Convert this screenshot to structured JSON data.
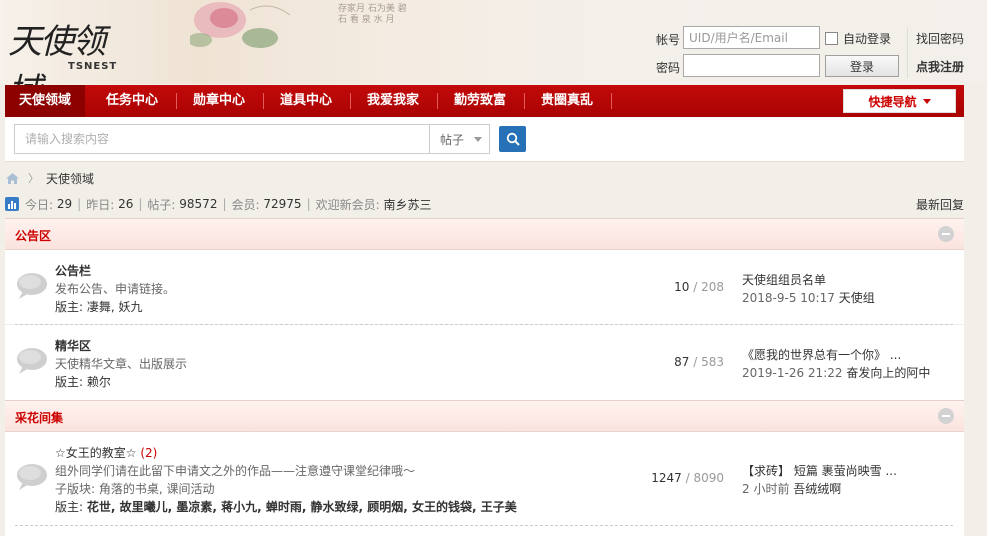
{
  "header": {
    "logo_text": "天使领域",
    "logo_sub": "TSNEST",
    "poem_lines": [
      "存家月  石为美 碧",
      "石 看    泉  水 月"
    ],
    "login": {
      "account_label": "帐号",
      "account_placeholder": "UID/用户名/Email",
      "password_label": "密码",
      "auto_login_label": "自动登录",
      "login_button": "登录",
      "find_password": "找回密码",
      "register": "点我注册"
    }
  },
  "nav": {
    "items": [
      "天使领域",
      "任务中心",
      "勋章中心",
      "道具中心",
      "我爱我家",
      "勤劳致富",
      "贵圈真乱"
    ],
    "quick_nav": "快捷导航"
  },
  "search": {
    "placeholder": "请输入搜索内容",
    "type": "帖子"
  },
  "breadcrumb": {
    "current": "天使领域"
  },
  "stats": {
    "today_label": "今日:",
    "today": "29",
    "yesterday_label": "昨日:",
    "yesterday": "26",
    "posts_label": "帖子:",
    "posts": "98572",
    "members_label": "会员:",
    "members": "72975",
    "newest_label": "欢迎新会员:",
    "newest_member": "南乡苏三",
    "latest_replies": "最新回复"
  },
  "sections": [
    {
      "title": "公告区",
      "forums": [
        {
          "name": "公告栏",
          "desc": "发布公告、申请链接。",
          "moderator_label": "版主:",
          "moderators": "凄舞, 妖九",
          "threads": "10",
          "posts": "/ 208",
          "last_title": "天使组组员名单",
          "last_time": "2018-9-5 10:17",
          "last_user": "天使组"
        },
        {
          "name": "精华区",
          "desc": "天使精华文章、出版展示",
          "moderator_label": "版主:",
          "moderators": "赖尔",
          "threads": "87",
          "posts": "/ 583",
          "last_title": "《愿我的世界总有一个你》 ...",
          "last_time": "2019-1-26 21:22",
          "last_user": "奋发向上的阿中"
        }
      ]
    },
    {
      "title": "采花间集",
      "forums": [
        {
          "name": "☆女王的教室☆",
          "today_count": "(2)",
          "desc": "组外同学们请在此留下申请文之外的作品——注意遵守课堂纪律哦～",
          "subforum_label": "子版块:",
          "subforums": "角落的书桌, 课间活动",
          "moderator_label": "版主:",
          "moderators": "花世, 故里曦儿, 墨凉素, 蒋小九, 蝉时雨, 静水致绿, 顾明烟, 女王的钱袋, 王子美",
          "threads": "1247",
          "posts": "/ 8090",
          "last_title": "【求砖】 短篇 裹萤尚映雪 ...",
          "last_time": "2 小时前",
          "last_user": "吾绒绒啊"
        }
      ]
    }
  ]
}
